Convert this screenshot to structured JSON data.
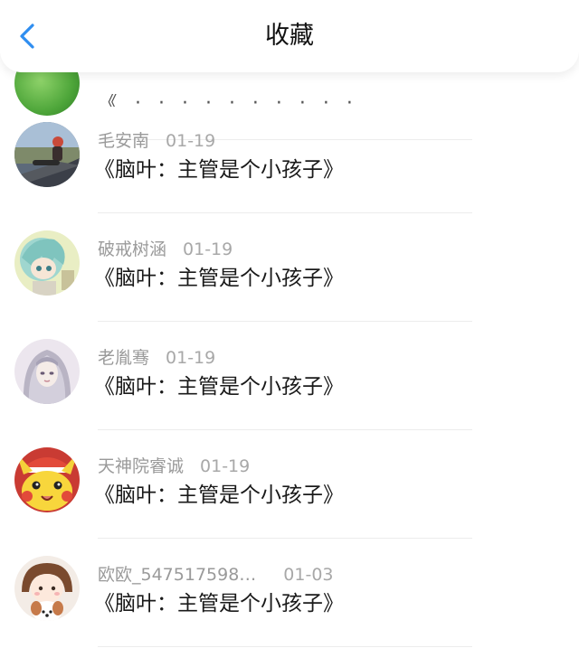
{
  "header": {
    "title": "收藏",
    "back_icon": "chevron-left-icon",
    "accent_color": "#2f8ef0"
  },
  "partial_item": {
    "text": "《 · · · · · · · · · · · · · · 》"
  },
  "favorites": [
    {
      "username": "毛安南",
      "date": "01-19",
      "title": "《脑叶：主管是个小孩子》",
      "avatar": "avatar-anime-figure-on-road"
    },
    {
      "username": "破戒树涵",
      "date": "01-19",
      "title": "《脑叶：主管是个小孩子》",
      "avatar": "avatar-anime-teal-hair"
    },
    {
      "username": "老胤骞",
      "date": "01-19",
      "title": "《脑叶：主管是个小孩子》",
      "avatar": "avatar-anime-silver-hair"
    },
    {
      "username": "天神院睿诚",
      "date": "01-19",
      "title": "《脑叶：主管是个小孩子》",
      "avatar": "avatar-pikachu"
    },
    {
      "username": "欧欧_547517598…",
      "date": "01-03",
      "title": "《脑叶：主管是个小孩子》",
      "avatar": "avatar-cartoon-girl-with-dog"
    }
  ]
}
